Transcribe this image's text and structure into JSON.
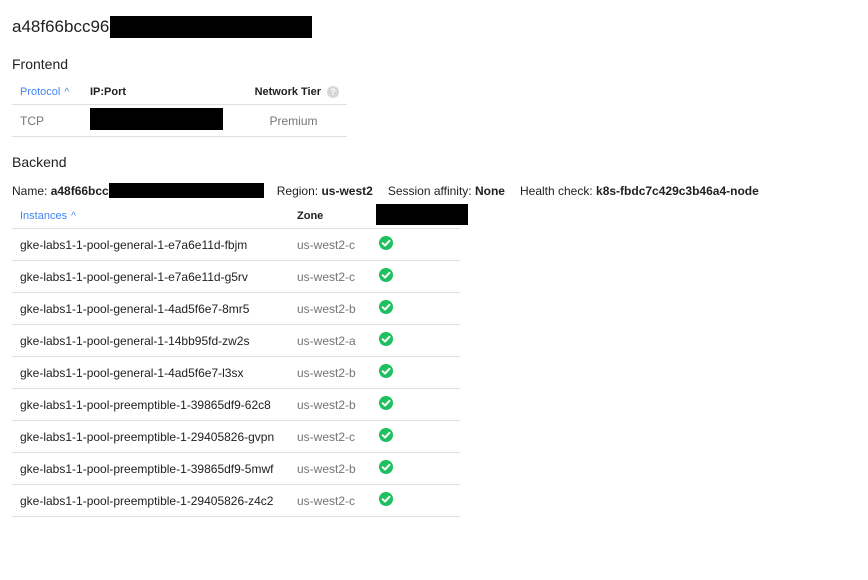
{
  "header": {
    "title_prefix": "a48f66bcc96"
  },
  "frontend": {
    "section_title": "Frontend",
    "columns": {
      "protocol": "Protocol",
      "ip_port": "IP:Port",
      "network_tier": "Network Tier"
    },
    "sort_icon": "chevron-up-icon",
    "help_icon": "help-circle-icon",
    "rows": [
      {
        "protocol": "TCP",
        "ip_port": "[redacted]",
        "network_tier": "Premium"
      }
    ]
  },
  "backend": {
    "section_title": "Backend",
    "name_label": "Name:",
    "name_value_prefix": "a48f66bcc",
    "region_label": "Region:",
    "region_value": "us-west2",
    "session_affinity_label": "Session affinity:",
    "session_affinity_value": "None",
    "health_check_label": "Health check:",
    "health_check_value": "k8s-fbdc7c429c3b46a4-node",
    "columns": {
      "instances": "Instances",
      "zone": "Zone",
      "status": "[redacted]"
    },
    "status_color": "#1ec05f",
    "instances": [
      {
        "name": "gke-labs1-1-pool-general-1-e7a6e11d-fbjm",
        "zone": "us-west2-c",
        "status": "healthy"
      },
      {
        "name": "gke-labs1-1-pool-general-1-e7a6e11d-g5rv",
        "zone": "us-west2-c",
        "status": "healthy"
      },
      {
        "name": "gke-labs1-1-pool-general-1-4ad5f6e7-8mr5",
        "zone": "us-west2-b",
        "status": "healthy"
      },
      {
        "name": "gke-labs1-1-pool-general-1-14bb95fd-zw2s",
        "zone": "us-west2-a",
        "status": "healthy"
      },
      {
        "name": "gke-labs1-1-pool-general-1-4ad5f6e7-l3sx",
        "zone": "us-west2-b",
        "status": "healthy"
      },
      {
        "name": "gke-labs1-1-pool-preemptible-1-39865df9-62c8",
        "zone": "us-west2-b",
        "status": "healthy"
      },
      {
        "name": "gke-labs1-1-pool-preemptible-1-29405826-gvpn",
        "zone": "us-west2-c",
        "status": "healthy"
      },
      {
        "name": "gke-labs1-1-pool-preemptible-1-39865df9-5mwf",
        "zone": "us-west2-b",
        "status": "healthy"
      },
      {
        "name": "gke-labs1-1-pool-preemptible-1-29405826-z4c2",
        "zone": "us-west2-c",
        "status": "healthy"
      }
    ]
  }
}
